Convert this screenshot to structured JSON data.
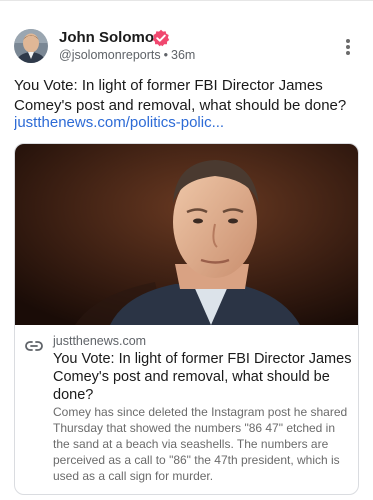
{
  "post": {
    "author": {
      "name": "John Solomon",
      "handle": "@jsolomonreports",
      "separator": "•",
      "time": "36m",
      "verified_color": "#f0486f"
    },
    "text": "You Vote: In light of former FBI Director James Comey's post and removal, what should be done?",
    "link_text": "justthenews.com/politics-polic..."
  },
  "card": {
    "domain": "justthenews.com",
    "title": "You Vote: In light of former FBI Director James Comey's post and removal, what should be done?",
    "description": "Comey has since deleted the Instagram post he shared Thursday that showed the numbers \"86 47\" etched in the sand at a beach via seashells. The numbers are perceived as a call to \"86\" the 47th president, which is used as a call sign for murder."
  },
  "colors": {
    "link": "#2d6bd6",
    "text": "#1a1a1a",
    "muted": "#5f6368"
  },
  "icons": {
    "verified": "verified-badge-icon",
    "more": "more-vertical-icon",
    "link": "link-icon"
  }
}
